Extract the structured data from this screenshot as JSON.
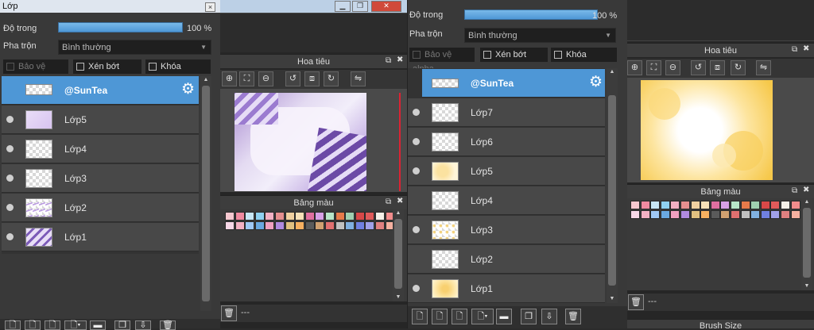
{
  "left_panel": {
    "title": "Lớp",
    "close": "×",
    "opacity_label": "Độ trong",
    "opacity_value": "100 %",
    "blend_label": "Pha trộn",
    "blend_value": "Bình thường",
    "protect_alpha": "Bảo vệ alpha",
    "clipping": "Xén bớt",
    "lock": "Khóa",
    "layers": [
      {
        "name": "@SunTea",
        "selected": true
      },
      {
        "name": "Lớp5"
      },
      {
        "name": "Lớp4"
      },
      {
        "name": "Lớp3"
      },
      {
        "name": "Lớp2"
      },
      {
        "name": "Lớp1"
      }
    ]
  },
  "middle_panel": {
    "navigator_title": "Hoa tiêu",
    "palette_title": "Bảng màu",
    "brush_status": "---",
    "window_buttons": [
      "▁",
      "❐",
      "✕"
    ]
  },
  "right_panel": {
    "opacity_label": "Độ trong",
    "opacity_value": "100 %",
    "blend_label": "Pha trộn",
    "blend_value": "Bình thường",
    "protect_alpha": "Bảo vệ alpha",
    "clipping": "Xén bớt",
    "lock": "Khóa",
    "layers": [
      {
        "name": "@SunTea",
        "selected": true
      },
      {
        "name": "Lớp7"
      },
      {
        "name": "Lớp6"
      },
      {
        "name": "Lớp5"
      },
      {
        "name": "Lớp4"
      },
      {
        "name": "Lớp3"
      },
      {
        "name": "Lớp2"
      },
      {
        "name": "Lớp1"
      }
    ]
  },
  "far_right_panel": {
    "navigator_title": "Hoa tiêu",
    "palette_title": "Bảng màu",
    "brush_status": "---",
    "brush_size_title": "Brush Size"
  },
  "palette_colors": [
    "#f5c7cf",
    "#f08aa0",
    "#c7e6f5",
    "#8fd0f0",
    "#f2b0c3",
    "#e58f8f",
    "#f0d0a0",
    "#f7e0b8",
    "#e06fa0",
    "#d7a0e6",
    "#b7e6c8",
    "#e67a4a",
    "#9fcfb0",
    "#d84848",
    "#e05a5a",
    "#f5f0e8",
    "#f28c8c",
    "#f7d7e7",
    "#f3b0c3",
    "#9fc8f5",
    "#6aa8e0",
    "#f0a0c0",
    "#b08adf",
    "#e0c080",
    "#f6b060",
    "#5a5a5a",
    "#d0a070",
    "#e07070",
    "#c0c0c0",
    "#80b0e0",
    "#7080e0",
    "#a0a0e8",
    "#e08080",
    "#f5b0a0"
  ]
}
